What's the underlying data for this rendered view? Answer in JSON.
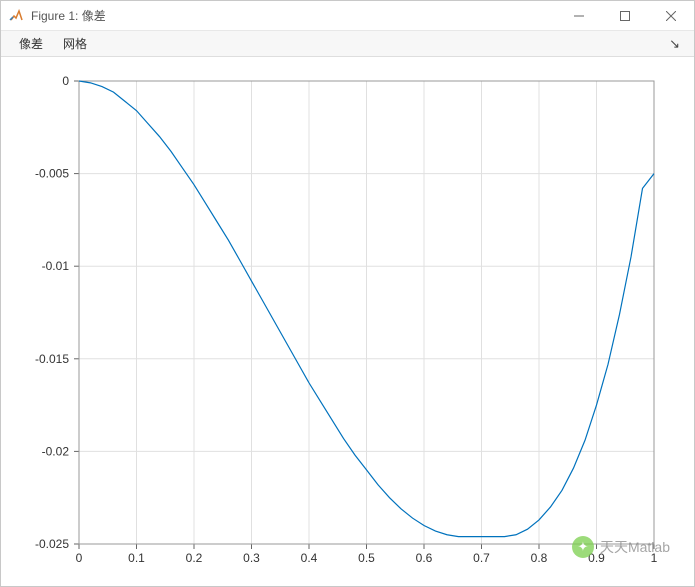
{
  "window": {
    "title": "Figure 1: 像差"
  },
  "menubar": {
    "items": [
      "像差",
      "网格"
    ]
  },
  "chart_data": {
    "type": "line",
    "xlabel": "",
    "ylabel": "",
    "xlim": [
      0,
      1
    ],
    "ylim": [
      -0.025,
      0
    ],
    "xticks": [
      0,
      0.1,
      0.2,
      0.3,
      0.4,
      0.5,
      0.6,
      0.7,
      0.8,
      0.9,
      1
    ],
    "yticks": [
      -0.025,
      -0.02,
      -0.015,
      -0.01,
      -0.005,
      0
    ],
    "x": [
      0,
      0.02,
      0.04,
      0.06,
      0.08,
      0.1,
      0.12,
      0.14,
      0.16,
      0.18,
      0.2,
      0.22,
      0.24,
      0.26,
      0.28,
      0.3,
      0.32,
      0.34,
      0.36,
      0.38,
      0.4,
      0.42,
      0.44,
      0.46,
      0.48,
      0.5,
      0.52,
      0.54,
      0.56,
      0.58,
      0.6,
      0.62,
      0.64,
      0.66,
      0.68,
      0.7,
      0.72,
      0.74,
      0.76,
      0.78,
      0.8,
      0.82,
      0.84,
      0.86,
      0.88,
      0.9,
      0.92,
      0.94,
      0.96,
      0.98,
      1.0
    ],
    "y": [
      0.0,
      -0.0001,
      -0.0003,
      -0.0006,
      -0.0011,
      -0.0016,
      -0.0023,
      -0.003,
      -0.0038,
      -0.0047,
      -0.0056,
      -0.0066,
      -0.0076,
      -0.0086,
      -0.0097,
      -0.0108,
      -0.0119,
      -0.013,
      -0.0141,
      -0.0152,
      -0.0163,
      -0.0173,
      -0.0183,
      -0.0193,
      -0.0202,
      -0.021,
      -0.0218,
      -0.0225,
      -0.0231,
      -0.0236,
      -0.024,
      -0.0243,
      -0.0245,
      -0.0246,
      -0.0246,
      -0.0246,
      -0.0246,
      -0.0246,
      -0.0245,
      -0.0242,
      -0.0237,
      -0.023,
      -0.0221,
      -0.0209,
      -0.0194,
      -0.0175,
      -0.0153,
      -0.0126,
      -0.0095,
      -0.0058,
      -0.005
    ]
  },
  "watermark": {
    "text": "天天Matlab"
  }
}
